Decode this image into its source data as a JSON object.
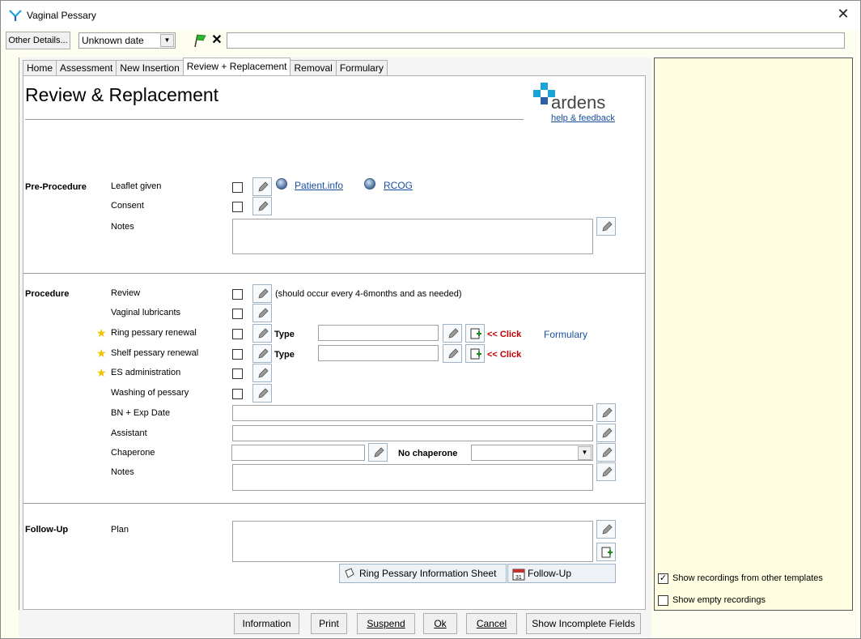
{
  "window": {
    "title": "Vaginal Pessary"
  },
  "toolbar": {
    "other_details_label": "Other Details...",
    "date_value": "Unknown date",
    "note_input_value": ""
  },
  "tabs": [
    {
      "label": "Home",
      "active": false
    },
    {
      "label": "Assessment",
      "active": false
    },
    {
      "label": "New Insertion",
      "active": false
    },
    {
      "label": "Review + Replacement",
      "active": true
    },
    {
      "label": "Removal",
      "active": false
    },
    {
      "label": "Formulary",
      "active": false
    }
  ],
  "page": {
    "title": "Review & Replacement",
    "logo_text": "ardens",
    "help_link": "help & feedback"
  },
  "pre_procedure": {
    "section_label": "Pre-Procedure",
    "leaflet_label": "Leaflet given",
    "consent_label": "Consent",
    "notes_label": "Notes",
    "link_patient_info": "Patient.info",
    "link_rcog": "RCOG"
  },
  "procedure": {
    "section_label": "Procedure",
    "review_label": "Review",
    "review_hint": "(should occur every 4-6months and as needed)",
    "lubricants_label": "Vaginal lubricants",
    "ring_label": "Ring pessary renewal",
    "shelf_label": "Shelf pessary renewal",
    "es_label": "ES administration",
    "washing_label": "Washing of pessary",
    "type_label": "Type",
    "click_label": "<< Click",
    "formulary_link": "Formulary",
    "bn_label": "BN + Exp Date",
    "assistant_label": "Assistant",
    "chaperone_label": "Chaperone",
    "no_chaperone_label": "No chaperone",
    "notes_label": "Notes"
  },
  "follow_up": {
    "section_label": "Follow-Up",
    "plan_label": "Plan",
    "ring_info_button": "Ring Pessary Information Sheet",
    "follow_up_button": "Follow-Up"
  },
  "footer": {
    "information": "Information",
    "print": "Print",
    "suspend": "Suspend",
    "ok": "Ok",
    "cancel": "Cancel",
    "show_incomplete": "Show Incomplete Fields"
  },
  "right_panel": {
    "show_other_templates": "Show recordings from other templates",
    "show_other_templates_checked": true,
    "show_empty": "Show empty recordings",
    "show_empty_checked": false
  },
  "colors": {
    "link": "#1a4fa0",
    "click_red": "#c00000",
    "star": "#f2c200",
    "right_panel_bg": "#fffee0",
    "brand_cyan": "#1aa3d9"
  }
}
